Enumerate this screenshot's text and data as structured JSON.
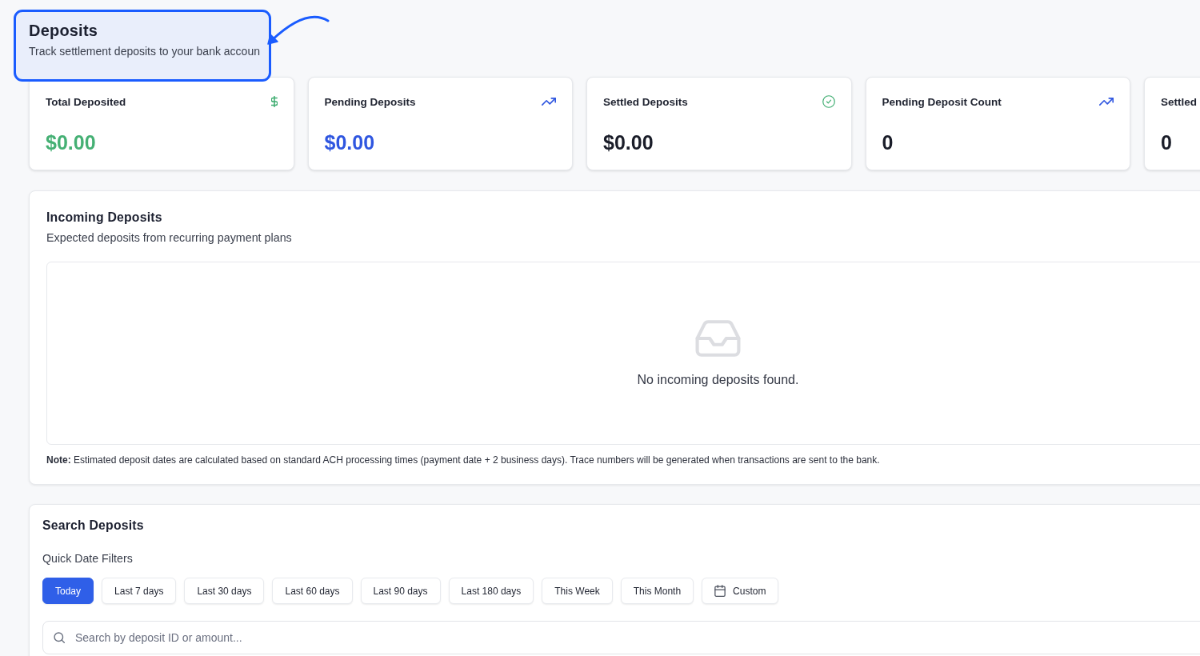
{
  "header": {
    "title": "Deposits",
    "subtitle": "Track settlement deposits to your bank accoun",
    "highlighted": true
  },
  "stats": [
    {
      "kind": "total",
      "label": "Total Deposited",
      "value": "$0.00"
    },
    {
      "kind": "pending",
      "label": "Pending Deposits",
      "value": "$0.00"
    },
    {
      "kind": "settled",
      "label": "Settled Deposits",
      "value": "$0.00"
    },
    {
      "kind": "pending_count",
      "label": "Pending Deposit Count",
      "value": "0"
    },
    {
      "kind": "settled_count",
      "label": "Settled",
      "value": "0"
    }
  ],
  "incoming": {
    "title": "Incoming Deposits",
    "subtitle": "Expected deposits from recurring payment plans",
    "empty_message": "No incoming deposits found.",
    "note": "**Note:** Estimated deposit dates are calculated based on standard ACH processing times (payment date + 2 business days). Trace numbers will be generated when transactions are sent to the bank."
  },
  "search": {
    "title": "Search Deposits",
    "filters_label": "Quick Date Filters",
    "filters": [
      {
        "label": "Today",
        "kind": "preset",
        "selected": true
      },
      {
        "label": "Last 7 days",
        "kind": "preset",
        "selected": false
      },
      {
        "label": "Last 30 days",
        "kind": "preset",
        "selected": false
      },
      {
        "label": "Last 60 days",
        "kind": "preset",
        "selected": false
      },
      {
        "label": "Last 90 days",
        "kind": "preset",
        "selected": false
      },
      {
        "label": "Last 180 days",
        "kind": "preset",
        "selected": false
      },
      {
        "label": "This Week",
        "kind": "preset",
        "selected": false
      },
      {
        "label": "This Month",
        "kind": "preset",
        "selected": false
      },
      {
        "label": "Custom",
        "kind": "custom",
        "selected": false
      }
    ],
    "placeholder": "Search by deposit ID or amount..."
  }
}
